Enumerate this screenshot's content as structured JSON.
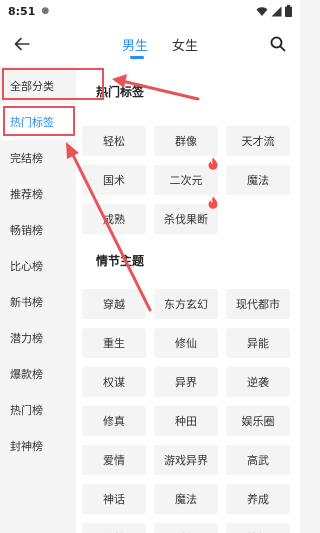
{
  "status_bar": {
    "time": "8:51"
  },
  "nav": {
    "tabs": [
      {
        "label": "男生"
      },
      {
        "label": "女生"
      }
    ]
  },
  "sidebar": {
    "items": [
      {
        "label": "全部分类"
      },
      {
        "label": "热门标签"
      },
      {
        "label": "完结榜"
      },
      {
        "label": "推荐榜"
      },
      {
        "label": "畅销榜"
      },
      {
        "label": "比心榜"
      },
      {
        "label": "新书榜"
      },
      {
        "label": "潜力榜"
      },
      {
        "label": "爆款榜"
      },
      {
        "label": "热门榜"
      },
      {
        "label": "封神榜"
      }
    ]
  },
  "sections": [
    {
      "title": "热门标签",
      "tags": [
        {
          "label": "轻松",
          "hot": false
        },
        {
          "label": "群像",
          "hot": false
        },
        {
          "label": "天才流",
          "hot": false
        },
        {
          "label": "国术",
          "hot": false
        },
        {
          "label": "二次元",
          "hot": true
        },
        {
          "label": "魔法",
          "hot": false
        },
        {
          "label": "成熟",
          "hot": false
        },
        {
          "label": "杀伐果断",
          "hot": true
        }
      ]
    },
    {
      "title": "情节主题",
      "tags": [
        {
          "label": "穿越",
          "hot": false
        },
        {
          "label": "东方玄幻",
          "hot": false
        },
        {
          "label": "现代都市",
          "hot": false
        },
        {
          "label": "重生",
          "hot": false
        },
        {
          "label": "修仙",
          "hot": false
        },
        {
          "label": "异能",
          "hot": false
        },
        {
          "label": "权谋",
          "hot": false
        },
        {
          "label": "异界",
          "hot": false
        },
        {
          "label": "逆袭",
          "hot": false
        },
        {
          "label": "修真",
          "hot": false
        },
        {
          "label": "种田",
          "hot": false
        },
        {
          "label": "娱乐圈",
          "hot": false
        },
        {
          "label": "爱情",
          "hot": false
        },
        {
          "label": "游戏异界",
          "hot": false
        },
        {
          "label": "高武",
          "hot": false
        },
        {
          "label": "神话",
          "hot": false
        },
        {
          "label": "魔法",
          "hot": false
        },
        {
          "label": "养成",
          "hot": false
        },
        {
          "label": "谍战",
          "hot": false
        },
        {
          "label": "科幻",
          "hot": false
        },
        {
          "label": "惊悚",
          "hot": false
        }
      ]
    }
  ],
  "icons": {
    "back": "arrow-left-icon",
    "search": "search-icon",
    "fire": "fire-icon",
    "wifi": "wifi-icon",
    "signal": "signal-icon",
    "battery": "battery-icon"
  },
  "colors": {
    "accent": "#2a8ef5",
    "highlight": "#e8535a",
    "fire": "#f0504a"
  }
}
